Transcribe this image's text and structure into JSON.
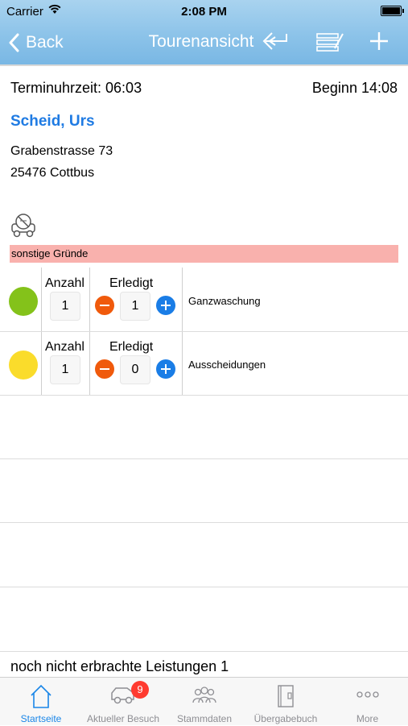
{
  "status_bar": {
    "carrier": "Carrier",
    "time": "2:08 PM"
  },
  "nav": {
    "back_label": "Back",
    "title": "Tourenansicht"
  },
  "visit": {
    "terminuhrzeit": "Terminuhrzeit: 06:03",
    "beginn": "Beginn 14:08",
    "client_name": "Scheid, Urs",
    "street": "Grabenstrasse 73",
    "city": "25476 Cottbus",
    "reason": "sonstige Gründe"
  },
  "services": [
    {
      "anzahl_label": "Anzahl",
      "anzahl": "1",
      "erledigt_label": "Erledigt",
      "erledigt": "1",
      "name": "Ganzwaschung",
      "color": "#84c21a"
    },
    {
      "anzahl_label": "Anzahl",
      "anzahl": "1",
      "erledigt_label": "Erledigt",
      "erledigt": "0",
      "name": "Ausscheidungen",
      "color": "#fadc2b"
    }
  ],
  "footer": {
    "text": "noch nicht erbrachte Leistungen 1"
  },
  "tabs": [
    {
      "label": "Startseite",
      "icon": "home-icon",
      "active": true
    },
    {
      "label": "Aktueller Besuch",
      "icon": "car-icon",
      "badge": "9"
    },
    {
      "label": "Stammdaten",
      "icon": "people-icon"
    },
    {
      "label": "Übergabebuch",
      "icon": "book-icon"
    },
    {
      "label": "More",
      "icon": "more-icon"
    }
  ],
  "colors": {
    "accent": "#1f7be3",
    "minus": "#f05a0c",
    "plus": "#1a7de6",
    "reason_bg": "#f9b1ad"
  }
}
